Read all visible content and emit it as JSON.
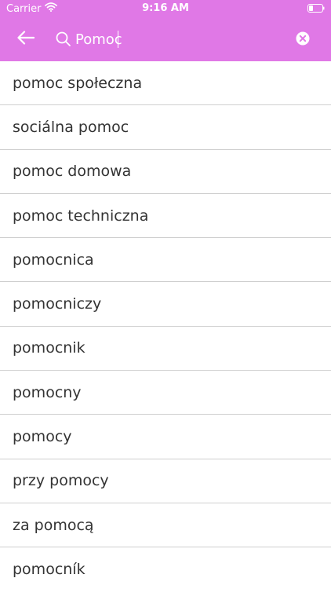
{
  "status_bar": {
    "carrier": "Carrier",
    "time": "9:16 AM",
    "wifi_icon": "wifi-icon",
    "battery_icon": "battery-icon"
  },
  "app_bar": {
    "background_color": "#e078e6",
    "back_icon": "arrow-left-icon",
    "search_icon": "search-icon",
    "clear_icon": "clear-circle-icon",
    "search_value": "Pomoc"
  },
  "results": [
    {
      "label": "pomoc społeczna"
    },
    {
      "label": "sociálna pomoc"
    },
    {
      "label": "pomoc domowa"
    },
    {
      "label": "pomoc techniczna"
    },
    {
      "label": "pomocnica"
    },
    {
      "label": "pomocniczy"
    },
    {
      "label": "pomocnik"
    },
    {
      "label": "pomocny"
    },
    {
      "label": "pomocy"
    },
    {
      "label": "przy pomocy"
    },
    {
      "label": "za pomocą"
    },
    {
      "label": "pomocník"
    }
  ]
}
